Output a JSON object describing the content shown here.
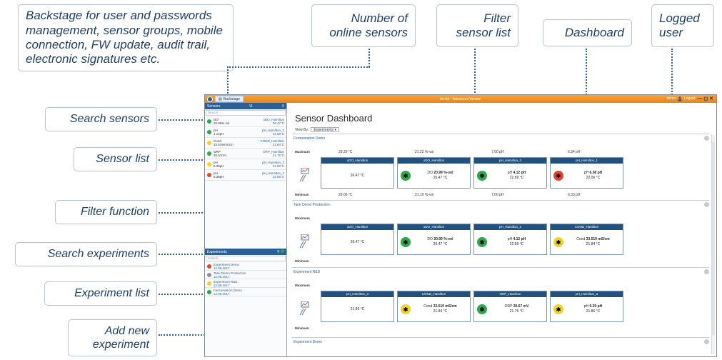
{
  "callouts": {
    "backstage": "Backstage for user and passwords management, sensor groups, mobile connection, FW update, audit trail, electronic signatures etc.",
    "online_sensors": "Number of online sensors",
    "filter_list": "Filter sensor list",
    "dashboard": "Dashboard",
    "logged_user": "Logged user",
    "search_sensors": "Search sensors",
    "sensor_list": "Sensor list",
    "filter_function": "Filter function",
    "search_experiments": "Search experiments",
    "experiment_list": "Experiment list",
    "add_experiment": "Add new experiment"
  },
  "app": {
    "backstage_tab": "Backstage",
    "title": "ArcAir - Advanced Version",
    "user": "demo",
    "logout": "Logout",
    "window_controls": "— ◻ ✕"
  },
  "sidebar": {
    "sensors_header": "Sensors",
    "sensor_count": "\\6",
    "search_placeholder": "Search...",
    "sensors": [
      {
        "left": "DO\n20.99% vol",
        "right": "oDO_Hamilton\n26.47°C",
        "color": "#2aa84a"
      },
      {
        "left": "pH\n4.12pH",
        "right": "pH_Hamilton_2\n22.89°C",
        "color": "#2aa84a"
      },
      {
        "left": "Cond\n33.519mS/cm",
        "right": "COND_Hamilton\n21.84°C",
        "color": "#f2d12a"
      },
      {
        "left": "ORP\n30.67mV",
        "right": "ORP_Hamilton\n21.75°C",
        "color": "#2aa84a"
      },
      {
        "left": "pH\n6.39pH",
        "right": "pH_Hamilton_3\n21.86°C",
        "color": "#f2d12a"
      },
      {
        "left": "pH\n6.38pH",
        "right": "pH_Hamilton_1\n22.06°C",
        "color": "#e0472a"
      }
    ],
    "experiments_header": "Experiments",
    "experiments": [
      {
        "name": "Experiment Demo\n12.08.2017",
        "color": "#e0472a"
      },
      {
        "name": "Tank Demo Production\n12.08.2017",
        "color": "#8a8f96"
      },
      {
        "name": "Experiment R&D\n12.08.2017",
        "color": "#f2d12a"
      },
      {
        "name": "Fermentation Demo\n12.08.2017",
        "color": "#2aa84a"
      }
    ]
  },
  "main": {
    "title": "Sensor Dashboard",
    "view_by_label": "View By:",
    "view_by_value": "Experiments",
    "groups": [
      {
        "title": "Fermentation Demo",
        "maximum_label": "Maximum",
        "minimum_label": "Minimum",
        "max": [
          "29.29 °C",
          "21.22 %-vol",
          "7.00 pH",
          "6.34 pH"
        ],
        "min": [
          "29.06 °C",
          "21.10 %-vol",
          "7.00 pH",
          "6.33 pH"
        ],
        "cards": [
          {
            "name": "oDO_Hamilton",
            "type": "DO",
            "value": "",
            "temp": "26.47 °C",
            "status": ""
          },
          {
            "name": "oDO_Hamilton",
            "type": "DO",
            "value": "20.99 %-vol",
            "temp": "26.47 °C",
            "status": "#2aa84a"
          },
          {
            "name": "pH_Hamilton_2",
            "type": "pH",
            "value": "4.12 pH",
            "temp": "22.89 °C",
            "status": "#2aa84a"
          },
          {
            "name": "pH_Hamilton_1",
            "type": "pH",
            "value": "6.38 pH",
            "temp": "22.06 °C",
            "status": "#e0472a"
          }
        ]
      },
      {
        "title": "Tank Demo Production",
        "maximum_label": "Maximum",
        "minimum_label": "Minimum",
        "cards": [
          {
            "name": "oDO_Hamilton",
            "type": "DO",
            "value": "",
            "temp": "26.47 °C",
            "status": ""
          },
          {
            "name": "oDO_Hamilton",
            "type": "DO",
            "value": "20.99 %-vol",
            "temp": "26.47 °C",
            "status": "#2aa84a"
          },
          {
            "name": "pH_Hamilton_2",
            "type": "pH",
            "value": "4.12 pH",
            "temp": "22.89 °C",
            "status": "#2aa84a"
          },
          {
            "name": "COND_Hamilton",
            "type": "Cond",
            "value": "33.519 mS/cm",
            "temp": "21.84 °C",
            "status": "#f2d12a"
          }
        ]
      },
      {
        "title": "Experiment R&D",
        "maximum_label": "Maximum",
        "minimum_label": "Minimum",
        "cards": [
          {
            "name": "pH_Hamilton_3",
            "type": "pH",
            "value": "",
            "temp": "21.86 °C",
            "status": ""
          },
          {
            "name": "COND_Hamilton",
            "type": "Cond",
            "value": "33.519 mS/cm",
            "temp": "21.84 °C",
            "status": "#f2d12a"
          },
          {
            "name": "ORP_Hamilton",
            "type": "ORP",
            "value": "30.67 mV",
            "temp": "21.75 °C",
            "status": "#2aa84a"
          },
          {
            "name": "pH_Hamilton_3",
            "type": "pH",
            "value": "6.39 pH",
            "temp": "21.86 °C",
            "status": "#f2d12a"
          }
        ]
      },
      {
        "title": "Experiment Demo"
      }
    ]
  }
}
